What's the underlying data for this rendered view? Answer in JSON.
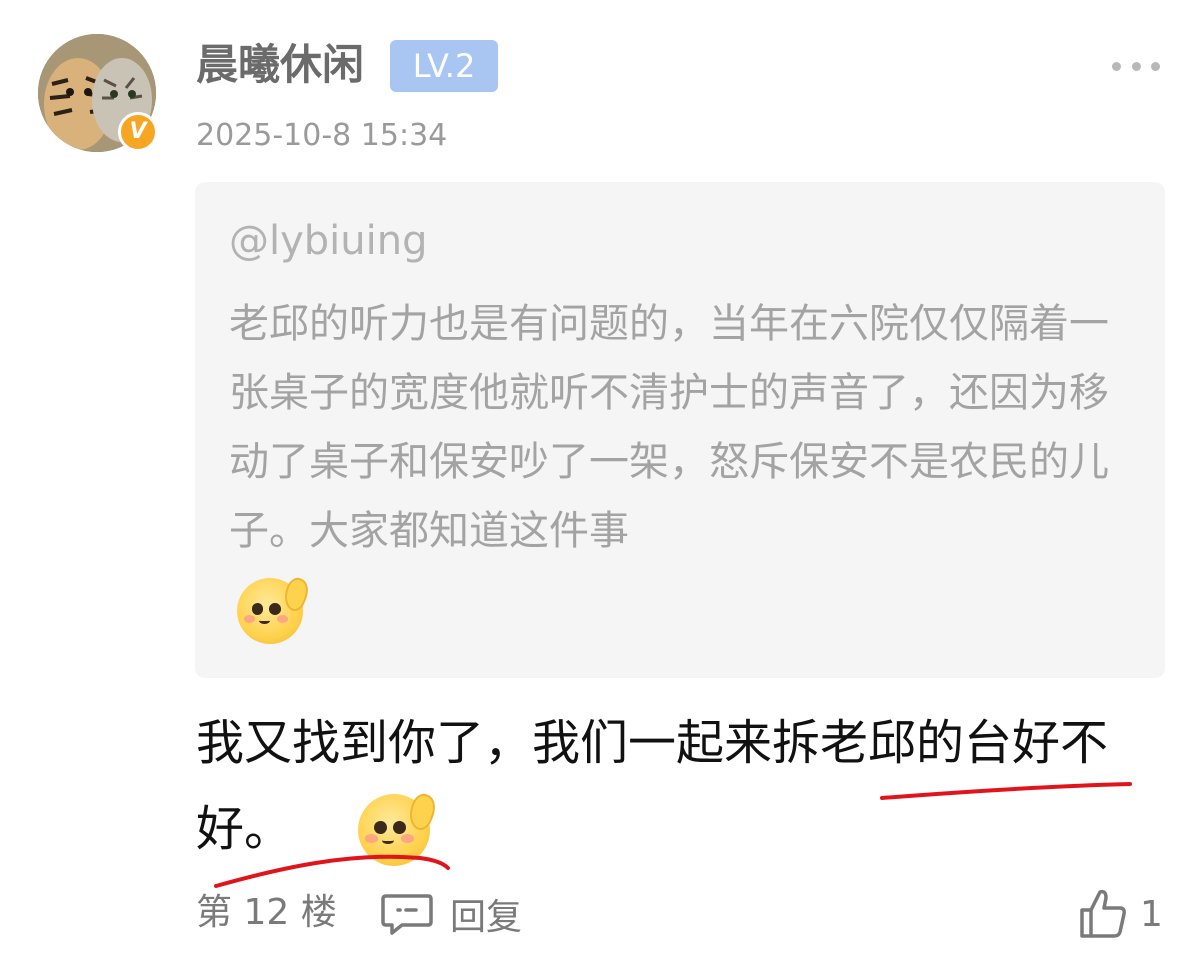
{
  "post": {
    "username": "晨曦休闲",
    "level": "LV.2",
    "timestamp": "2025-10-8 15:34",
    "verified_mark": "V"
  },
  "quote": {
    "user": "@lybiuing",
    "text": "老邱的听力也是有问题的，当年在六院仅仅隔着一张桌子的宽度他就听不清护士的声音了，还因为移动了桌子和保安吵了一架，怒斥保安不是农民的儿子。大家都知道这件事",
    "emoji": "blush-emoji"
  },
  "reply": {
    "text": "我又找到你了，我们一起来拆老邱的台好不好。",
    "emoji": "blush-emoji"
  },
  "footer": {
    "floor": "第 12 楼",
    "reply_label": "回复",
    "like_count": "1"
  },
  "colors": {
    "level_badge": "#a9c6f3",
    "verify_badge": "#f6a623",
    "quote_background": "#f5f5f5",
    "annotation_red": "#e0141a"
  }
}
